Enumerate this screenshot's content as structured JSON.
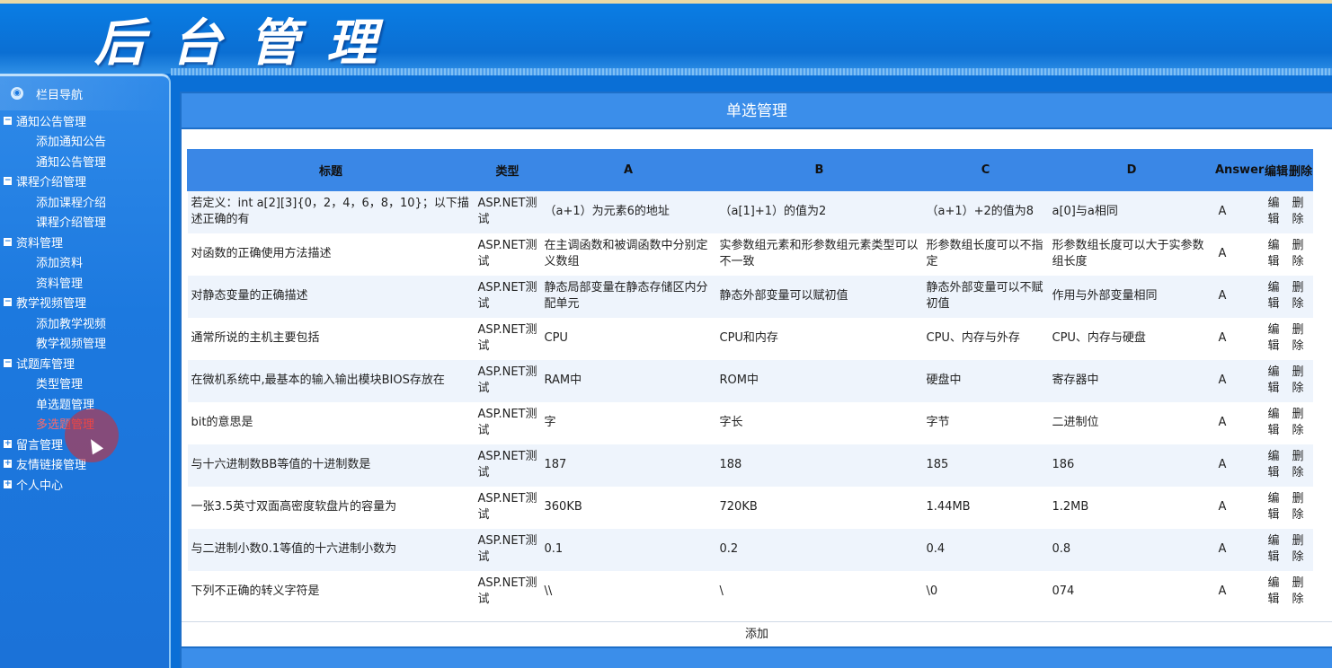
{
  "header": {
    "title": "后台管理"
  },
  "sidebar": {
    "heading": "栏目导航",
    "groups": [
      {
        "label": "通知公告管理",
        "toggle": "−",
        "items": [
          "添加通知公告",
          "通知公告管理"
        ]
      },
      {
        "label": "课程介绍管理",
        "toggle": "−",
        "items": [
          "添加课程介绍",
          "课程介绍管理"
        ]
      },
      {
        "label": "资料管理",
        "toggle": "−",
        "items": [
          "添加资料",
          "资料管理"
        ]
      },
      {
        "label": "教学视频管理",
        "toggle": "−",
        "items": [
          "添加教学视频",
          "教学视频管理"
        ]
      },
      {
        "label": "试题库管理",
        "toggle": "−",
        "items": [
          "类型管理",
          "单选题管理",
          "多选题管理"
        ]
      },
      {
        "label": "留言管理",
        "toggle": "+",
        "items": []
      },
      {
        "label": "友情链接管理",
        "toggle": "+",
        "items": []
      },
      {
        "label": "个人中心",
        "toggle": "+",
        "items": []
      }
    ]
  },
  "main": {
    "title": "单选管理",
    "columns": [
      "标题",
      "类型",
      "A",
      "B",
      "C",
      "D",
      "Answer",
      "编辑",
      "删除"
    ],
    "rows": [
      {
        "title": "若定义：int a[2][3]{0，2，4，6，8，10}；以下描述正确的有",
        "type": "ASP.NET测试",
        "a": "（a+1）为元素6的地址",
        "b": "（a[1]+1）的值为2",
        "c": "（a+1）+2的值为8",
        "d": "a[0]与a相同",
        "answer": "A"
      },
      {
        "title": "对函数的正确使用方法描述",
        "type": "ASP.NET测试",
        "a": "在主调函数和被调函数中分别定义数组",
        "b": "实参数组元素和形参数组元素类型可以不一致",
        "c": "形参数组长度可以不指定",
        "d": "形参数组长度可以大于实参数组长度",
        "answer": "A"
      },
      {
        "title": "对静态变量的正确描述",
        "type": "ASP.NET测试",
        "a": "静态局部变量在静态存储区内分配单元",
        "b": "静态外部变量可以赋初值",
        "c": "静态外部变量可以不赋初值",
        "d": "作用与外部变量相同",
        "answer": "A"
      },
      {
        "title": "通常所说的主机主要包括",
        "type": "ASP.NET测试",
        "a": "CPU",
        "b": "CPU和内存",
        "c": "CPU、内存与外存",
        "d": "CPU、内存与硬盘",
        "answer": "A"
      },
      {
        "title": "在微机系统中,最基本的输入输出模块BIOS存放在",
        "type": "ASP.NET测试",
        "a": "RAM中",
        "b": "ROM中",
        "c": "硬盘中",
        "d": "寄存器中",
        "answer": "A"
      },
      {
        "title": "bit的意思是",
        "type": "ASP.NET测试",
        "a": "字",
        "b": "字长",
        "c": "字节",
        "d": "二进制位",
        "answer": "A"
      },
      {
        "title": "与十六进制数BB等值的十进制数是",
        "type": "ASP.NET测试",
        "a": "187",
        "b": "188",
        "c": "185",
        "d": "186",
        "answer": "A"
      },
      {
        "title": "一张3.5英寸双面高密度软盘片的容量为",
        "type": "ASP.NET测试",
        "a": "360KB",
        "b": "720KB",
        "c": "1.44MB",
        "d": "1.2MB",
        "answer": "A"
      },
      {
        "title": "与二进制小数0.1等值的十六进制小数为",
        "type": "ASP.NET测试",
        "a": "0.1",
        "b": "0.2",
        "c": "0.4",
        "d": "0.8",
        "answer": "A"
      },
      {
        "title": "下列不正确的转义字符是",
        "type": "ASP.NET测试",
        "a": "\\\\",
        "b": "\\",
        "c": "\\0",
        "d": "074",
        "answer": "A"
      }
    ],
    "edit_label": "编辑",
    "delete_label": "删除",
    "add_label": "添加"
  }
}
